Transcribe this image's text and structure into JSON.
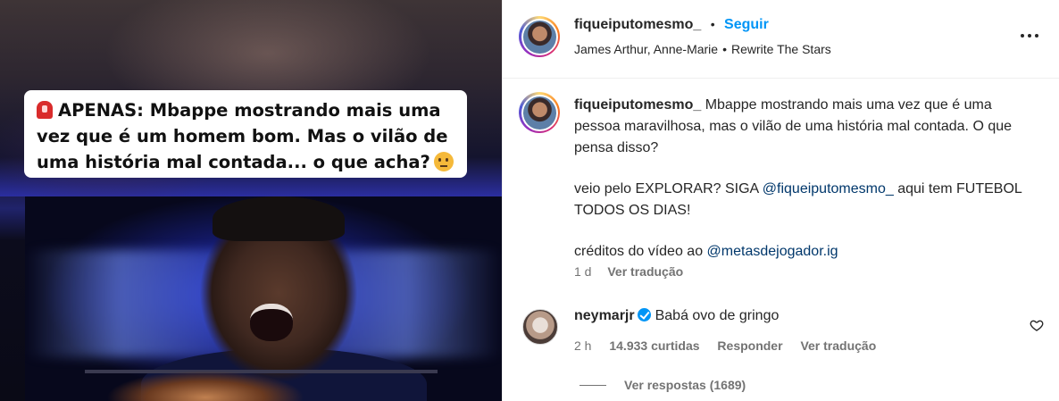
{
  "media": {
    "caption_lines": [
      "APENAS: Mbappe mostrando mais uma",
      "vez que é um homem bom. Mas o vilão de",
      "uma história mal contada... o que acha?"
    ]
  },
  "header": {
    "username": "fiqueiputomesmo_",
    "dot": "•",
    "follow_label": "Seguir",
    "music_artist": "James Arthur, Anne-Marie",
    "music_sep": "•",
    "music_title": "Rewrite The Stars"
  },
  "post": {
    "username": "fiqueiputomesmo_",
    "caption": "Mbappe mostrando mais uma vez que é uma pessoa maravilhosa, mas o vilão de uma história mal contada. O que pensa disso?",
    "line2_prefix": "veio pelo EXPLORAR? SIGA",
    "line2_mention": "@fiqueiputomesmo_",
    "line2_suffix": "aqui tem FUTEBOL TODOS OS DIAS!",
    "line3_prefix": "créditos do vídeo ao",
    "line3_mention": "@metasdejogador.ig",
    "time": "1 d",
    "translate_label": "Ver tradução"
  },
  "comment": {
    "username": "neymarjr",
    "text": "Babá ovo de gringo",
    "time": "2 h",
    "likes": "14.933 curtidas",
    "reply_label": "Responder",
    "translate_label": "Ver tradução",
    "view_replies": "Ver respostas (1689)"
  },
  "colors": {
    "accent": "#0095f6",
    "mention": "#00376b",
    "secondary_text": "#737373"
  },
  "icons": {
    "more": "more-horizontal-icon",
    "like": "heart-icon",
    "verified": "verified-badge-icon",
    "siren": "siren-emoji-icon",
    "thinking": "thinking-face-emoji-icon"
  }
}
